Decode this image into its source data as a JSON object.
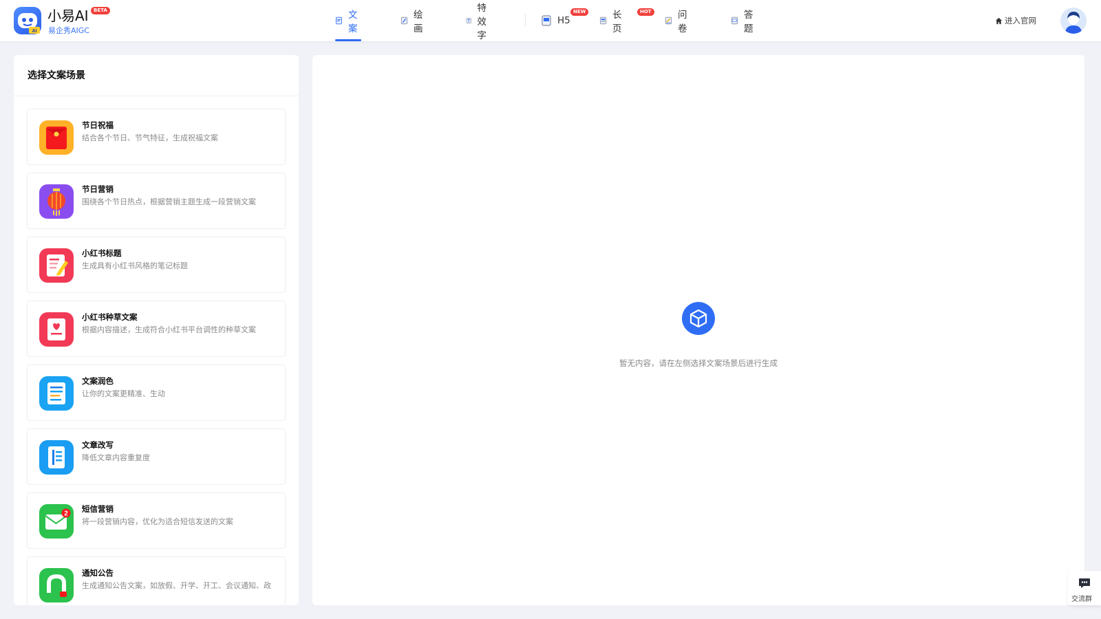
{
  "brand": {
    "name": "小易AI",
    "badge": "BETA",
    "subtitle": "易企秀AIGC",
    "logo_letter": "AI"
  },
  "nav": {
    "items": [
      {
        "label": "文案",
        "icon": "document-icon",
        "active": true
      },
      {
        "label": "绘画",
        "icon": "paint-icon",
        "active": false
      },
      {
        "label": "特效字",
        "icon": "text-effect-icon",
        "active": false
      },
      {
        "label": "H5",
        "icon": "h5-icon",
        "active": false,
        "badge": "NEW"
      },
      {
        "label": "长页",
        "icon": "long-page-icon",
        "active": false,
        "badge": "HOT"
      },
      {
        "label": "问卷",
        "icon": "survey-icon",
        "active": false
      },
      {
        "label": "答题",
        "icon": "quiz-icon",
        "active": false
      }
    ]
  },
  "header_right": {
    "site_link": "进入官网",
    "site_icon": "home-icon",
    "avatar_icon": "user-avatar"
  },
  "left_panel": {
    "title": "选择文案场景",
    "scenes": [
      {
        "name": "节日祝福",
        "desc": "结合各个节日、节气特征，生成祝福文案",
        "icon": "red-envelope-icon"
      },
      {
        "name": "节日营销",
        "desc": "围绕各个节日热点，根据营销主题生成一段营销文案",
        "icon": "lantern-icon"
      },
      {
        "name": "小红书标题",
        "desc": "生成具有小红书风格的笔记标题",
        "icon": "notepad-pencil-icon"
      },
      {
        "name": "小红书种草文案",
        "desc": "根据内容描述，生成符合小红书平台调性的种草文案",
        "icon": "heart-note-icon"
      },
      {
        "name": "文案润色",
        "desc": "让你的文案更精准、生动",
        "icon": "document-lines-icon"
      },
      {
        "name": "文章改写",
        "desc": "降低文章内容重复度",
        "icon": "article-rewrite-icon"
      },
      {
        "name": "短信营销",
        "desc": "将一段营销内容，优化为适合短信发送的文案",
        "icon": "mail-icon",
        "badge": "2"
      },
      {
        "name": "通知公告",
        "desc": "生成通知公告文案，如放假、开学、开工、会议通知、政",
        "icon": "megaphone-icon"
      }
    ]
  },
  "right_panel": {
    "empty_icon": "cube-icon",
    "empty_text": "暂无内容，请在左侧选择文案场景后进行生成"
  },
  "float_button": {
    "label": "交流群",
    "icon": "chat-bubble-icon"
  },
  "colors": {
    "accent": "#2f6df5",
    "badge_red": "#f0403c",
    "background": "#f0f2f7"
  }
}
